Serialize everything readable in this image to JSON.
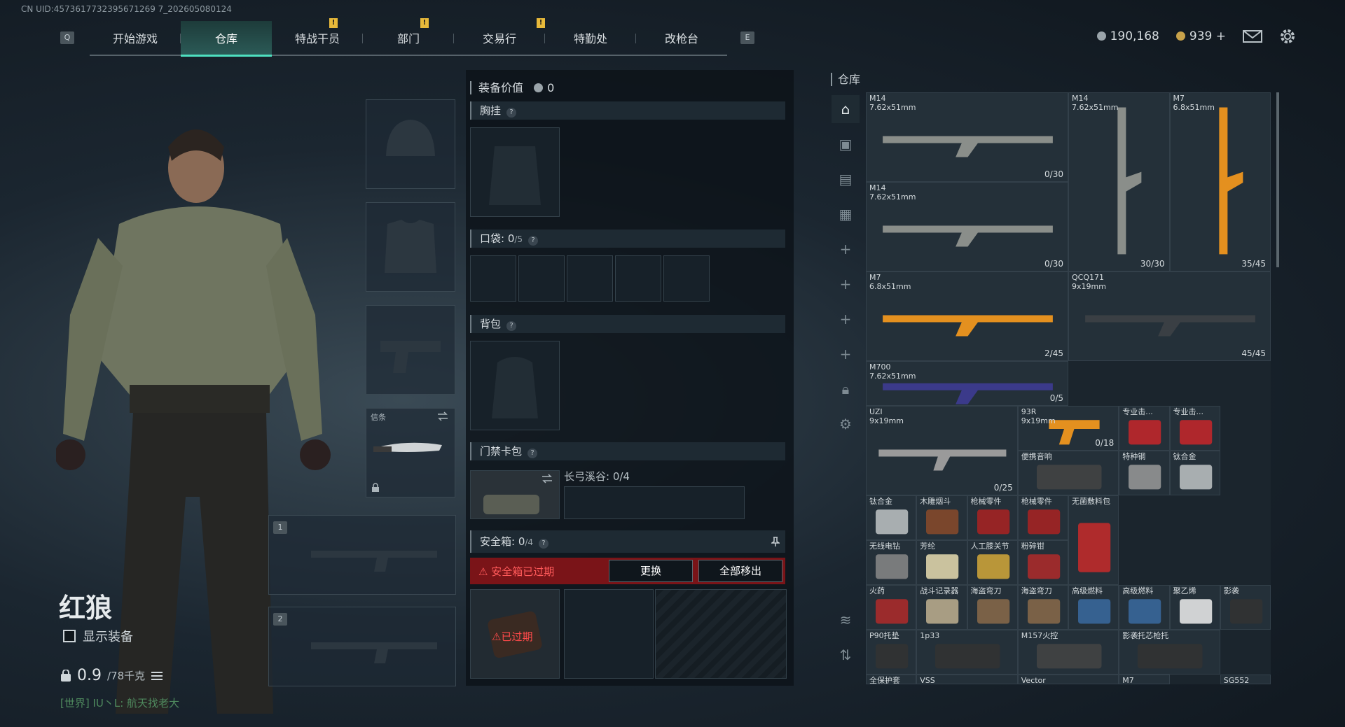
{
  "uid": "CN UID:4573617732395671269 7_202605080124",
  "nav": {
    "key_left": "Q",
    "key_right": "E",
    "tabs": [
      {
        "label": "开始游戏",
        "active": false
      },
      {
        "label": "仓库",
        "active": true
      },
      {
        "label": "特战干员",
        "active": false
      },
      {
        "label": "部门",
        "active": false
      },
      {
        "label": "交易行",
        "active": false
      },
      {
        "label": "特勤处",
        "active": false
      },
      {
        "label": "改枪台",
        "active": false
      }
    ],
    "alert_mark": "!"
  },
  "currency": {
    "silver": "190,168",
    "gold": "939",
    "plus": "+"
  },
  "character": {
    "name": "红狼",
    "show_gear": "显示装备",
    "weight_value": "0.9",
    "weight_max": "/78千克",
    "chat": "[世界] IU丶L: 航天找老大"
  },
  "equip_slots": {
    "melee_label": "信条"
  },
  "weapon_slots": [
    "1",
    "2"
  ],
  "middle": {
    "value_label": "装备价值",
    "value": "0",
    "chest": "胸挂",
    "pocket_label": "口袋:",
    "pocket_val": "0",
    "pocket_max": "/5",
    "backpack": "背包",
    "keycard": "门禁卡包",
    "keycard_loc": "长弓溪谷: 0/4",
    "safe_label": "安全箱:",
    "safe_val": "0",
    "safe_max": "/4",
    "safe_expired": "安全箱已过期",
    "swap": "更换",
    "move_all": "全部移出",
    "expired": "已过期"
  },
  "warehouse": {
    "title": "仓库",
    "items": [
      {
        "name": "M14",
        "cal": "7.62x51mm",
        "ammo": "0/30"
      },
      {
        "name": "M14",
        "cal": "7.62x51mm",
        "ammo": "30/30"
      },
      {
        "name": "M7",
        "cal": "6.8x51mm",
        "ammo": "35/45"
      },
      {
        "name": "M14",
        "cal": "7.62x51mm",
        "ammo": "0/30"
      },
      {
        "name": "M7",
        "cal": "6.8x51mm",
        "ammo": "2/45"
      },
      {
        "name": "QCQ171",
        "cal": "9x19mm",
        "ammo": "45/45"
      },
      {
        "name": "M700",
        "cal": "7.62x51mm",
        "ammo": "0/5"
      },
      {
        "name": "UZI",
        "cal": "9x19mm",
        "ammo": "0/25"
      },
      {
        "name": "93R",
        "cal": "9x19mm",
        "ammo": "0/18"
      },
      {
        "name": "专业击...",
        "cal": "",
        "ammo": ""
      },
      {
        "name": "专业击...",
        "cal": "",
        "ammo": ""
      },
      {
        "name": "便携音响",
        "cal": "",
        "ammo": ""
      },
      {
        "name": "特种钢",
        "cal": "",
        "ammo": ""
      },
      {
        "name": "钛合金",
        "cal": "",
        "ammo": ""
      },
      {
        "name": "钛合金",
        "cal": "",
        "ammo": ""
      },
      {
        "name": "木雕烟斗",
        "cal": "",
        "ammo": ""
      },
      {
        "name": "枪械零件",
        "cal": "",
        "ammo": ""
      },
      {
        "name": "枪械零件",
        "cal": "",
        "ammo": ""
      },
      {
        "name": "无菌敷料包",
        "cal": "",
        "ammo": ""
      },
      {
        "name": "无线电钻",
        "cal": "",
        "ammo": ""
      },
      {
        "name": "芳纶",
        "cal": "",
        "ammo": ""
      },
      {
        "name": "人工膝关节",
        "cal": "",
        "ammo": ""
      },
      {
        "name": "粉碎钳",
        "cal": "",
        "ammo": ""
      },
      {
        "name": "火药",
        "cal": "",
        "ammo": ""
      },
      {
        "name": "战斗记录器",
        "cal": "",
        "ammo": ""
      },
      {
        "name": "海盗弯刀",
        "cal": "",
        "ammo": ""
      },
      {
        "name": "海盗弯刀",
        "cal": "",
        "ammo": ""
      },
      {
        "name": "高级燃料",
        "cal": "",
        "ammo": ""
      },
      {
        "name": "高级燃料",
        "cal": "",
        "ammo": ""
      },
      {
        "name": "聚乙烯",
        "cal": "",
        "ammo": ""
      },
      {
        "name": "影袭",
        "cal": "",
        "ammo": ""
      },
      {
        "name": "P90托垫",
        "cal": "",
        "ammo": ""
      },
      {
        "name": "1p33",
        "cal": "",
        "ammo": ""
      },
      {
        "name": "M157火控",
        "cal": "",
        "ammo": ""
      },
      {
        "name": "影袭托芯枪托",
        "cal": "",
        "ammo": ""
      },
      {
        "name": "全保护套",
        "cal": "",
        "ammo": ""
      },
      {
        "name": "VSS",
        "cal": "",
        "ammo": ""
      },
      {
        "name": "Vector",
        "cal": "",
        "ammo": ""
      },
      {
        "name": "M7",
        "cal": "",
        "ammo": ""
      },
      {
        "name": "SG552",
        "cal": "",
        "ammo": ""
      }
    ]
  },
  "colors": {
    "accent": "#4ee0c0",
    "alert": "#e7b93a",
    "danger": "#c8262a",
    "orange_skin": "#e4901f"
  }
}
